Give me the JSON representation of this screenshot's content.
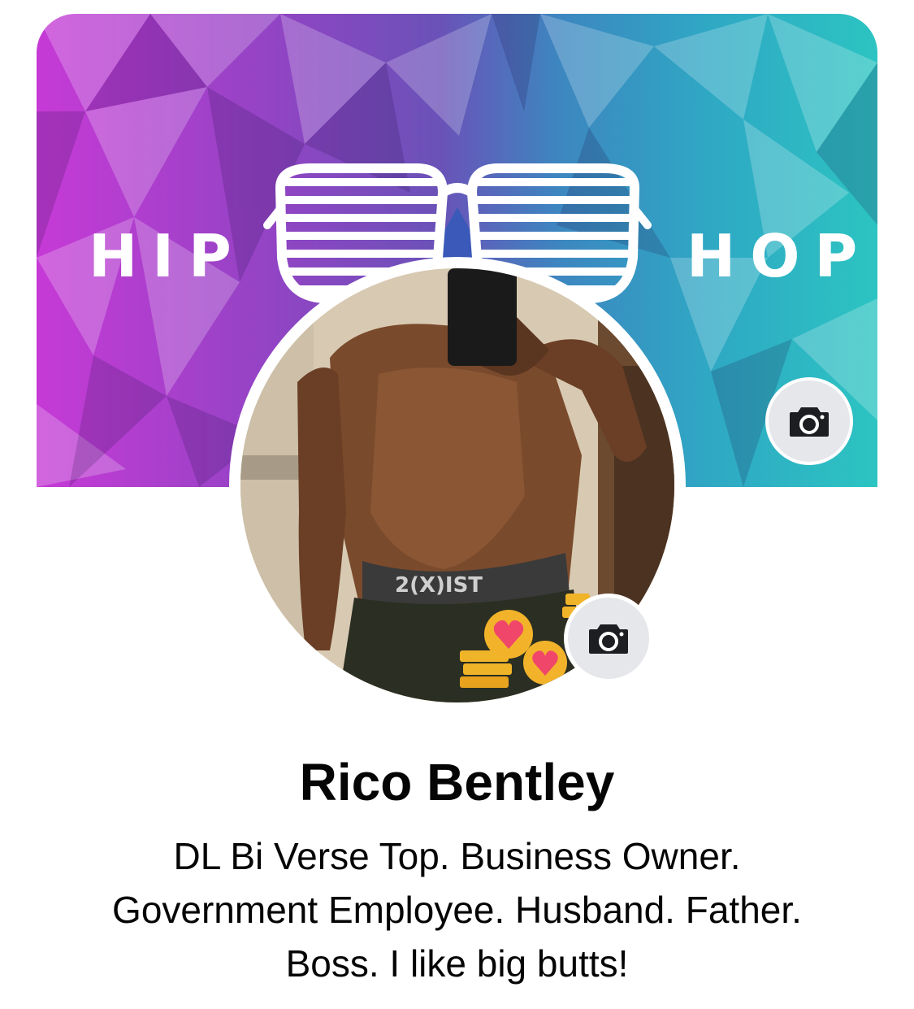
{
  "cover": {
    "word_left": "HIP",
    "word_right": "HOP",
    "colors": {
      "left": "#c63ad6",
      "middle": "#6a52b8",
      "right": "#2cc4c2"
    },
    "camera_icon": "camera-icon"
  },
  "avatar": {
    "description_icon": "profile-photo",
    "waistband_text": "2(X)IST",
    "camera_icon": "camera-icon"
  },
  "profile": {
    "name": "Rico Bentley",
    "bio_lines": [
      "DL Bi Verse Top. Business Owner.",
      "Government Employee. Husband. Father.",
      "Boss. I like big butts!"
    ]
  }
}
